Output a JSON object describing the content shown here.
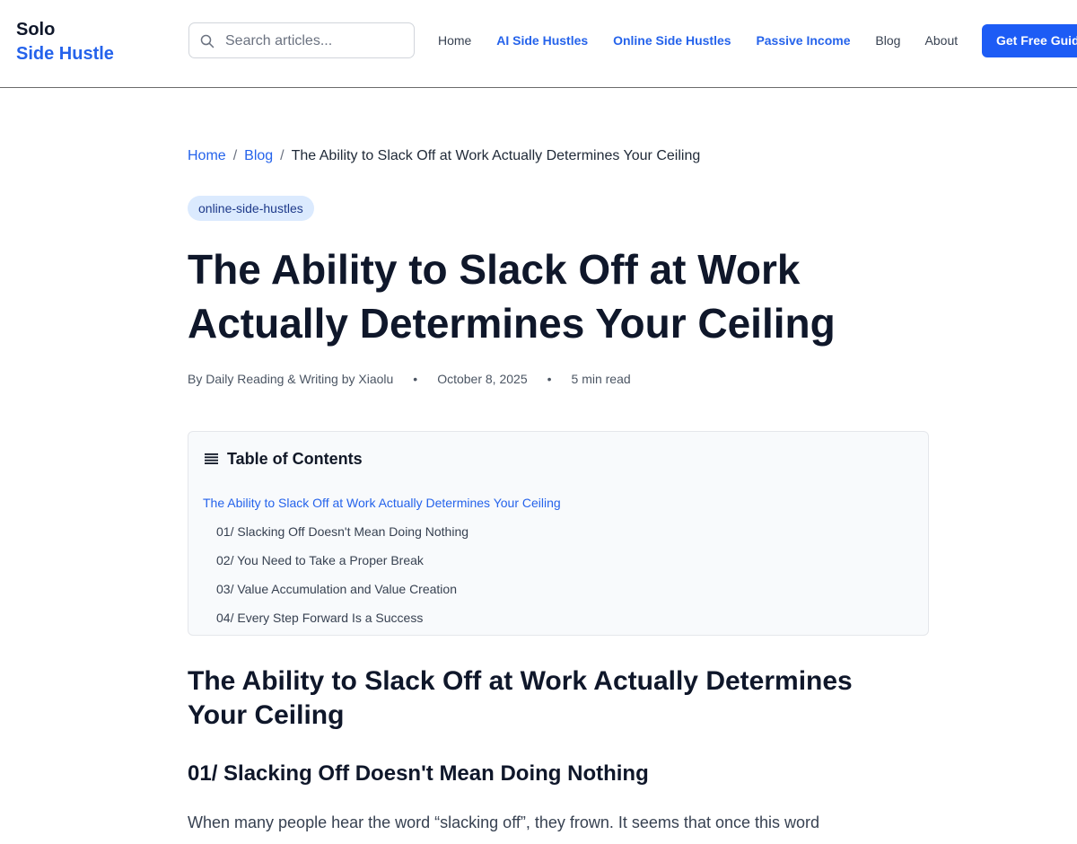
{
  "header": {
    "logo_line1": "Solo",
    "logo_line2": "Side Hustle",
    "search_placeholder": "Search articles...",
    "nav": [
      {
        "label": "Home",
        "accent": false
      },
      {
        "label": "AI Side Hustles",
        "accent": true
      },
      {
        "label": "Online Side Hustles",
        "accent": true
      },
      {
        "label": "Passive Income",
        "accent": true
      },
      {
        "label": "Blog",
        "accent": false
      },
      {
        "label": "About",
        "accent": false
      }
    ],
    "cta_label": "Get Free Guide"
  },
  "breadcrumb": {
    "home": "Home",
    "blog": "Blog",
    "separator": "/",
    "current": "The Ability to Slack Off at Work Actually Determines Your Ceiling"
  },
  "article": {
    "tag": "online-side-hustles",
    "title": "The Ability to Slack Off at Work Actually Determines Your Ceiling",
    "author": "By Daily Reading & Writing by Xiaolu",
    "date": "October 8, 2025",
    "read_time": "5 min read",
    "meta_separator": "•",
    "toc": {
      "heading": "Table of Contents",
      "items": [
        "The Ability to Slack Off at Work Actually Determines Your Ceiling",
        "01/ Slacking Off Doesn't Mean Doing Nothing",
        "02/ You Need to Take a Proper Break",
        "03/ Value Accumulation and Value Creation",
        "04/ Every Step Forward Is a Success"
      ]
    },
    "section_heading": "The Ability to Slack Off at Work Actually Determines Your Ceiling",
    "subsection_heading": "01/ Slacking Off Doesn't Mean Doing Nothing",
    "paragraph": "When many people hear the word “slacking off”, they frown. It seems that once this word"
  },
  "colors": {
    "accent": "#2563eb",
    "cta": "#1d5cf5",
    "tag_bg": "#dbeafe",
    "toc_bg": "#f8fafc"
  },
  "icons": [
    "search-icon",
    "list-icon"
  ]
}
